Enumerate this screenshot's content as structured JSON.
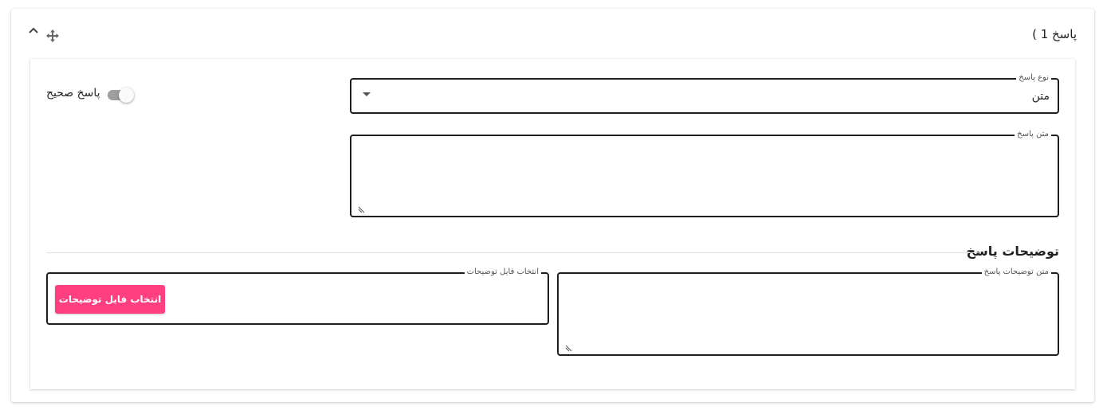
{
  "header": {
    "title": "پاسخ 1 )"
  },
  "answer_type": {
    "label": "نوع پاسخ",
    "value": "متن"
  },
  "answer_text": {
    "label": "متن پاسخ",
    "value": ""
  },
  "correct_toggle": {
    "label": "پاسخ صحیح",
    "checked": false
  },
  "explanations": {
    "title": "توضیحات پاسخ",
    "text_label": "متن توضیحات پاسخ",
    "text_value": "",
    "file_label": "انتخاب فایل توضیحات",
    "file_button": "انتخاب فایل توضیحات"
  },
  "colors": {
    "accent_button": "#ff3f7f",
    "field_border": "#1e1e1e",
    "toggle_off": "#9e9e9e"
  },
  "icons": {
    "collapse": "chevron-up-icon",
    "move": "move-arrows-icon",
    "dropdown": "caret-down-icon",
    "resize": "resize-grip-icon"
  }
}
